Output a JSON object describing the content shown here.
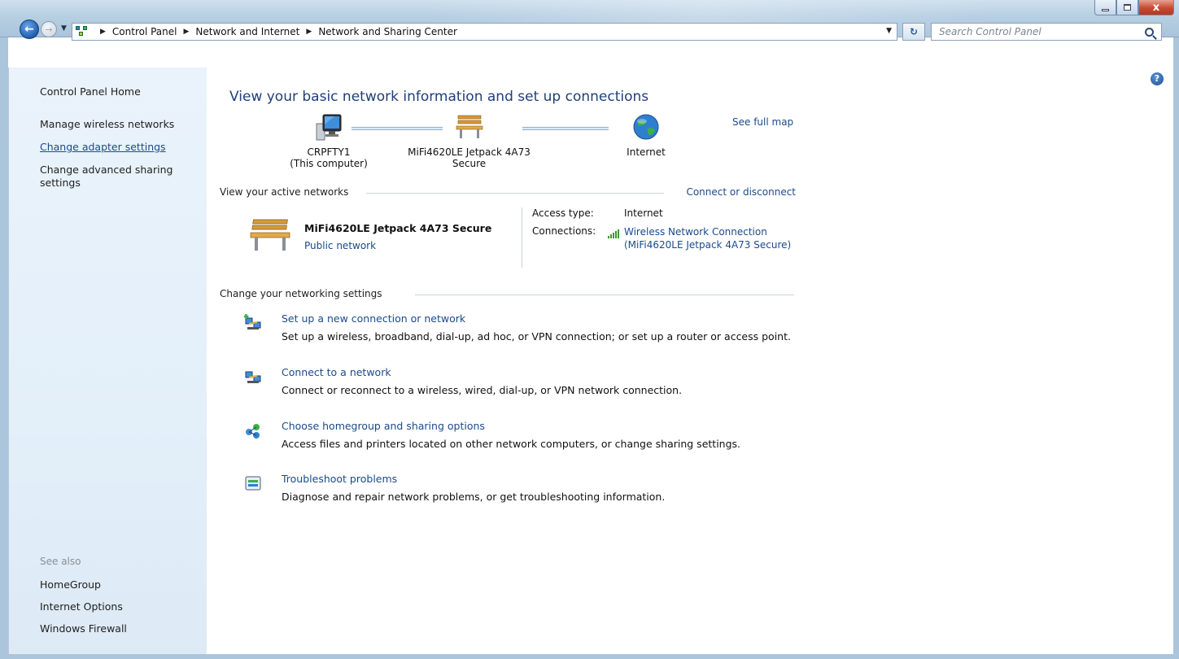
{
  "window": {
    "minimize": "",
    "maximize": "",
    "close": "x"
  },
  "address": {
    "breadcrumbs": [
      "Control Panel",
      "Network and Internet",
      "Network and Sharing Center"
    ]
  },
  "search": {
    "placeholder": "Search Control Panel"
  },
  "sidebar": {
    "items": [
      {
        "label": "Control Panel Home"
      },
      {
        "label": "Manage wireless networks"
      },
      {
        "label": "Change adapter settings"
      },
      {
        "label": "Change advanced sharing settings"
      }
    ],
    "see_also_label": "See also",
    "see_also": [
      {
        "label": "HomeGroup"
      },
      {
        "label": "Internet Options"
      },
      {
        "label": "Windows Firewall"
      }
    ]
  },
  "main": {
    "title": "View your basic network information and set up connections",
    "see_full_map": "See full map",
    "map": {
      "computer_name": "CRPFTY1",
      "computer_sub": "(This computer)",
      "network_name": "MiFi4620LE Jetpack 4A73 Secure",
      "internet_label": "Internet"
    },
    "active_networks": {
      "heading": "View your active networks",
      "connect_link": "Connect or disconnect",
      "network_name": "MiFi4620LE Jetpack 4A73 Secure",
      "network_type": "Public network",
      "access_type_label": "Access type:",
      "access_type_value": "Internet",
      "connections_label": "Connections:",
      "connection_link": "Wireless Network Connection (MiFi4620LE Jetpack 4A73 Secure)"
    },
    "change_settings": {
      "heading": "Change your networking settings",
      "tasks": [
        {
          "title": "Set up a new connection or network",
          "desc": "Set up a wireless, broadband, dial-up, ad hoc, or VPN connection; or set up a router or access point."
        },
        {
          "title": "Connect to a network",
          "desc": "Connect or reconnect to a wireless, wired, dial-up, or VPN network connection."
        },
        {
          "title": "Choose homegroup and sharing options",
          "desc": "Access files and printers located on other network computers, or change sharing settings."
        },
        {
          "title": "Troubleshoot problems",
          "desc": "Diagnose and repair network problems, or get troubleshooting information."
        }
      ]
    },
    "help": "?"
  },
  "colors": {
    "link": "#1a4a8c",
    "title": "#1f3f77",
    "sidebar_bg": "#e3eff9",
    "frame": "#aac5dc"
  }
}
